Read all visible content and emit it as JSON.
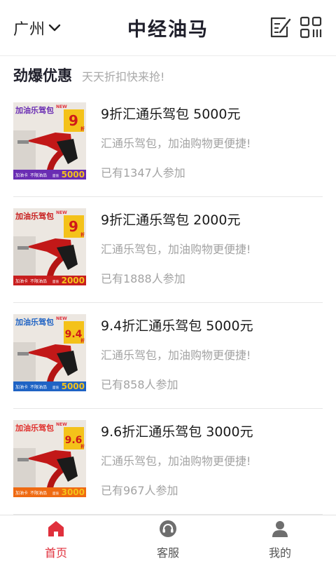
{
  "header": {
    "city": "广州",
    "title": "中经油马",
    "icons": {
      "left": "chevron-down-icon",
      "edit": "edit-note-icon",
      "qr": "qr-code-icon"
    }
  },
  "section": {
    "title": "劲爆优惠",
    "subtitle": "天天折扣快来抢!"
  },
  "items": [
    {
      "title": "9折汇通乐驾包 5000元",
      "desc": "汇通乐驾包，加油购物更便捷!",
      "count": "已有1347人参加",
      "thumb": {
        "label": "加油乐驾包",
        "badge_tag": "NEW",
        "discount": "9",
        "discount_unit": "折",
        "amount": "5000",
        "footer_left": "加油卡",
        "footer_mid": "不限油品",
        "footer_small": "面值",
        "theme": "#6a2db3",
        "label_color": "#6a2db3"
      }
    },
    {
      "title": "9折汇通乐驾包 2000元",
      "desc": "汇通乐驾包，加油购物更便捷!",
      "count": "已有1888人参加",
      "thumb": {
        "label": "加油乐驾包",
        "badge_tag": "NEW",
        "discount": "9",
        "discount_unit": "折",
        "amount": "2000",
        "footer_left": "加油卡",
        "footer_mid": "不限油品",
        "footer_small": "面值",
        "theme": "#c81e1e",
        "label_color": "#c81e1e"
      }
    },
    {
      "title": "9.4折汇通乐驾包 5000元",
      "desc": "汇通乐驾包，加油购物更便捷!",
      "count": "已有858人参加",
      "thumb": {
        "label": "加油乐驾包",
        "badge_tag": "NEW",
        "discount": "9.4",
        "discount_unit": "折",
        "amount": "5000",
        "footer_left": "加油卡",
        "footer_mid": "不限油品",
        "footer_small": "面值",
        "theme": "#1f63c4",
        "label_color": "#1f63c4"
      }
    },
    {
      "title": "9.6折汇通乐驾包 3000元",
      "desc": "汇通乐驾包，加油购物更便捷!",
      "count": "已有967人参加",
      "thumb": {
        "label": "加油乐驾包",
        "badge_tag": "NEW",
        "discount": "9.6",
        "discount_unit": "折",
        "amount": "3000",
        "footer_left": "加油卡",
        "footer_mid": "不限油品",
        "footer_small": "面值",
        "theme": "#ef6a12",
        "label_color": "#e0302c"
      }
    }
  ],
  "tabbar": {
    "tabs": [
      {
        "label": "首页",
        "icon": "home-icon",
        "active": true
      },
      {
        "label": "客服",
        "icon": "headset-icon",
        "active": false
      },
      {
        "label": "我的",
        "icon": "user-icon",
        "active": false
      }
    ]
  },
  "colors": {
    "accent": "#e0303c",
    "title_text": "#1f1f2b",
    "muted_text": "#a3a3a3",
    "discount_badge": "#f4c21a"
  }
}
